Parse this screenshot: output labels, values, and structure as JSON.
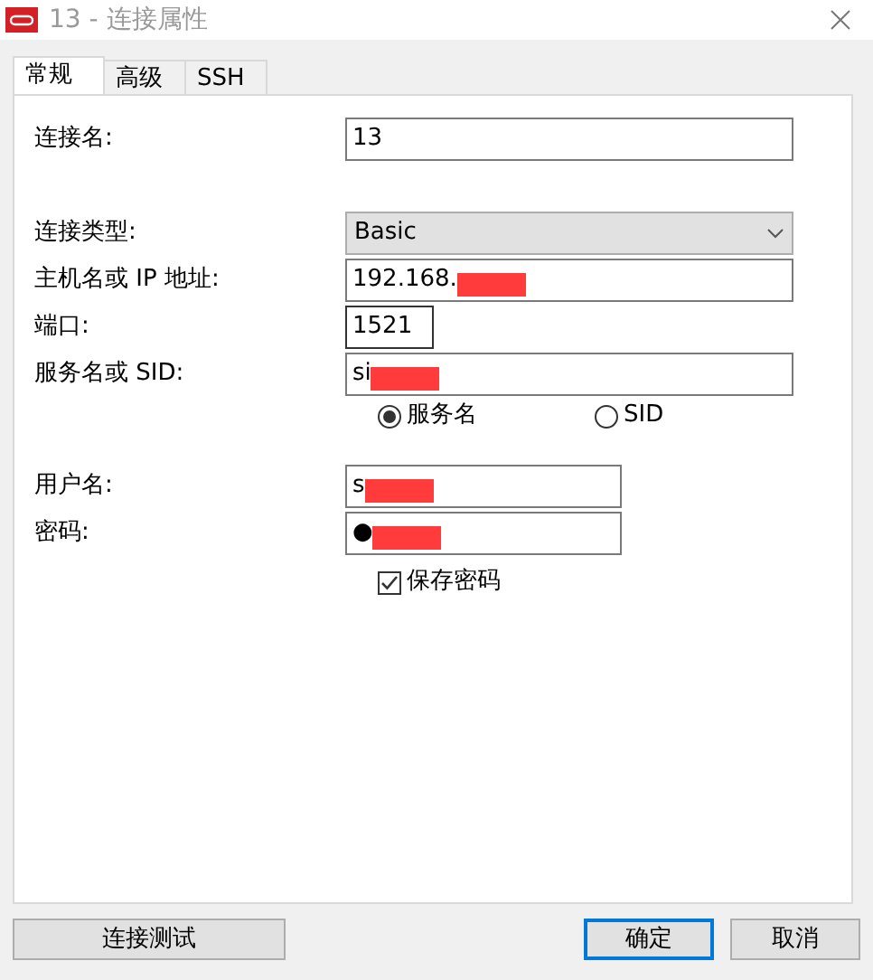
{
  "window": {
    "title": "13 - 连接属性"
  },
  "tabs": [
    {
      "label": "常规",
      "selected": true
    },
    {
      "label": "高级",
      "selected": false
    },
    {
      "label": "SSH",
      "selected": false
    }
  ],
  "fields": [
    {
      "kind": "text",
      "label": "连接名:",
      "value": "13",
      "redacted": false
    },
    {
      "kind": "select",
      "label": "连接类型:",
      "value": "Basic"
    },
    {
      "kind": "text",
      "label": "主机名或 IP 地址:",
      "value": "192.168.",
      "redacted": true
    },
    {
      "kind": "port",
      "label": "端口:",
      "value": "1521",
      "redacted": false
    },
    {
      "kind": "text",
      "label": "服务名或 SID:",
      "value": "si",
      "redacted": true
    },
    {
      "kind": "radio",
      "options": [
        {
          "label": "服务名",
          "selected": true
        },
        {
          "label": "SID",
          "selected": false
        }
      ]
    },
    {
      "kind": "credential",
      "label": "用户名:",
      "value": "s",
      "redacted": true
    },
    {
      "kind": "credential",
      "label": "密码:",
      "value": "●",
      "redacted": true
    },
    {
      "kind": "checkbox",
      "label": "保存密码",
      "checked": true
    }
  ],
  "buttons": [
    {
      "label": "连接测试",
      "default": false
    },
    {
      "label": "确定",
      "default": true
    },
    {
      "label": "取消",
      "default": false
    }
  ]
}
